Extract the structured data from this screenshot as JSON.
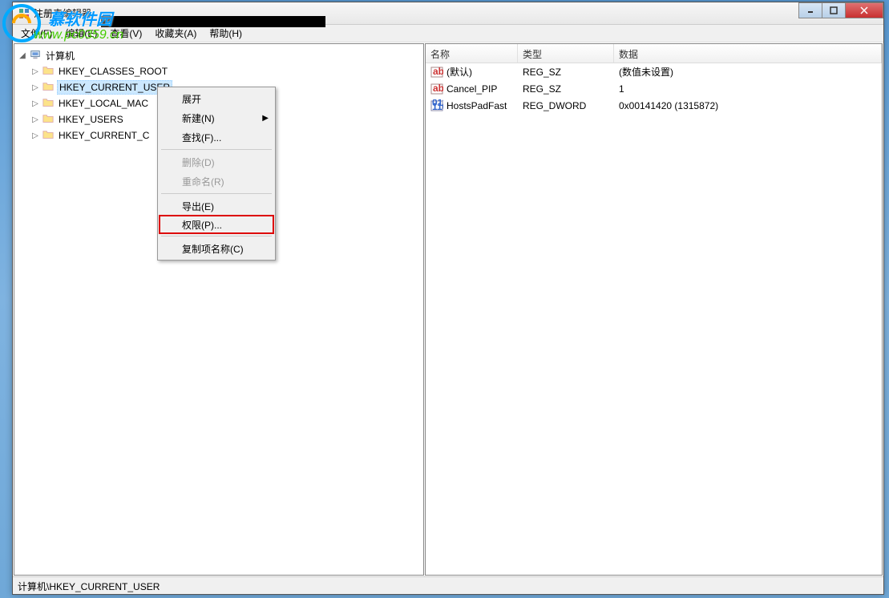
{
  "window": {
    "title": "注册表编辑器"
  },
  "watermark": {
    "slogan": "慕软件园",
    "url": "www.pc0359.cn"
  },
  "menubar": {
    "file": "文件(F)",
    "edit": "编辑(E)",
    "view": "查看(V)",
    "favorites": "收藏夹(A)",
    "help": "帮助(H)"
  },
  "tree": {
    "root": "计算机",
    "nodes": [
      {
        "label": "HKEY_CLASSES_ROOT"
      },
      {
        "label": "HKEY_CURRENT_USER",
        "selected": true
      },
      {
        "label": "HKEY_LOCAL_MAC"
      },
      {
        "label": "HKEY_USERS"
      },
      {
        "label": "HKEY_CURRENT_C"
      }
    ]
  },
  "list": {
    "headers": {
      "name": "名称",
      "type": "类型",
      "data": "数据"
    },
    "rows": [
      {
        "icon": "string",
        "name": "(默认)",
        "type": "REG_SZ",
        "data": "(数值未设置)"
      },
      {
        "icon": "string",
        "name": "Cancel_PIP",
        "type": "REG_SZ",
        "data": "1"
      },
      {
        "icon": "binary",
        "name": "HostsPadFast",
        "type": "REG_DWORD",
        "data": "0x00141420 (1315872)"
      }
    ]
  },
  "context_menu": {
    "expand": "展开",
    "new": "新建(N)",
    "find": "查找(F)...",
    "delete": "删除(D)",
    "rename": "重命名(R)",
    "export": "导出(E)",
    "permissions": "权限(P)...",
    "copy_key_name": "复制项名称(C)"
  },
  "statusbar": {
    "path": "计算机\\HKEY_CURRENT_USER"
  }
}
